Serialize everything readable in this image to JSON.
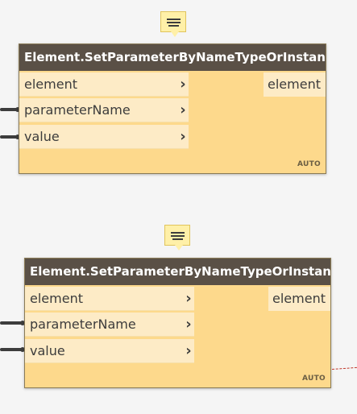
{
  "nodes": [
    {
      "title": "Element.SetParameterByNameTypeOrInstance",
      "inputs": [
        "element",
        "parameterName",
        "value"
      ],
      "output": "element",
      "lacing": "AUTO"
    },
    {
      "title": "Element.SetParameterByNameTypeOrInstance",
      "inputs": [
        "element",
        "parameterName",
        "value"
      ],
      "output": "element",
      "lacing": "AUTO"
    }
  ],
  "icons": {
    "preview_bubble": "preview-bubble-icon",
    "port_arrow": "chevron-right-icon"
  },
  "colors": {
    "node_body": "#fdd98c",
    "node_header": "#5a5046",
    "port_background": "#fdebc6",
    "wire": "#3d3d3d",
    "note_bubble": "#fff0a8",
    "dashed_wire": "#c0392b"
  }
}
